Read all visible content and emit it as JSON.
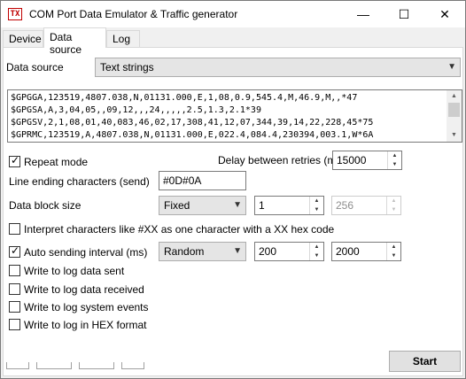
{
  "window": {
    "app_icon_text": "TX",
    "title": "COM Port Data Emulator & Traffic generator",
    "minimize_glyph": "—",
    "maximize_glyph": "☐",
    "close_glyph": "✕"
  },
  "tabs": [
    {
      "label": "Device",
      "active": false
    },
    {
      "label": "Data source",
      "active": true
    },
    {
      "label": "Log",
      "active": false
    }
  ],
  "data_source": {
    "label": "Data source",
    "value": "Text strings"
  },
  "text_strings": [
    "$GPGGA,123519,4807.038,N,01131.000,E,1,08,0.9,545.4,M,46.9,M,,*47",
    "$GPGSA,A,3,04,05,,09,12,,,24,,,,,2.5,1.3,2.1*39",
    "$GPGSV,2,1,08,01,40,083,46,02,17,308,41,12,07,344,39,14,22,228,45*75",
    "$GPRMC,123519,A,4807.038,N,01131.000,E,022.4,084.4,230394,003.1,W*6A"
  ],
  "repeat_mode": {
    "label": "Repeat mode",
    "checked": true
  },
  "delay": {
    "label": "Delay between retries (ms)",
    "value": "15000"
  },
  "line_ending": {
    "label": "Line ending characters (send)",
    "value": "#0D#0A"
  },
  "block_size": {
    "label": "Data block size",
    "mode": "Fixed",
    "value": "1",
    "max_value": "256"
  },
  "interpret_chars": {
    "label": "Interpret characters like #XX as one character with a XX hex code",
    "checked": false
  },
  "auto_send": {
    "label": "Auto sending interval (ms)",
    "checked": true,
    "mode": "Random",
    "min": "200",
    "max": "2000"
  },
  "log_options": [
    {
      "label": "Write to log data sent",
      "checked": false
    },
    {
      "label": "Write to log data received",
      "checked": false
    },
    {
      "label": "Write to log system events",
      "checked": false
    },
    {
      "label": "Write to log in HEX format",
      "checked": false
    }
  ],
  "start_button": {
    "label": "Start"
  },
  "icons": {
    "dropdown": "chevron-down-icon",
    "spin_up": "spin-up-icon",
    "spin_down": "spin-down-icon",
    "check": "check-icon"
  }
}
